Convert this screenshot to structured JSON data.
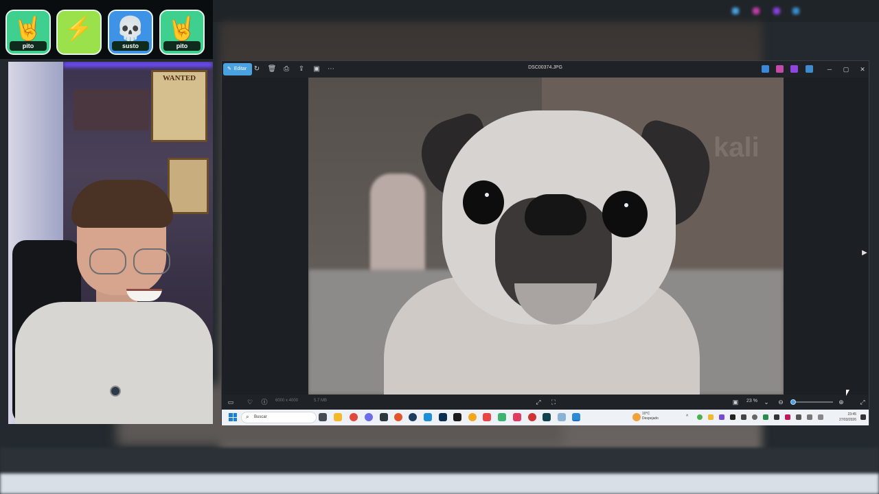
{
  "emotes": [
    {
      "label": "pito",
      "icon": "rock-hand-icon",
      "glyph": "🤘",
      "bg": "#3fcf8e"
    },
    {
      "label": "",
      "icon": "lightning-icon",
      "glyph": "⚡",
      "bg": "#9be14b"
    },
    {
      "label": "susto",
      "icon": "skull-icon",
      "glyph": "💀",
      "bg": "#3e93e6"
    },
    {
      "label": "pito",
      "icon": "rock-hand-icon",
      "glyph": "🤘",
      "bg": "#3fcf8e"
    }
  ],
  "webcam": {
    "poster_text": "WANTED"
  },
  "photos_app": {
    "edit_label": "Editar",
    "filename": "DSC00374.JPG",
    "toolbar_icons": [
      "rotate-icon",
      "delete-icon",
      "print-icon",
      "share-icon",
      "slideshow-icon",
      "more-icon"
    ],
    "status": {
      "dimensions": "6000 x 4000",
      "file_size": "5.7 MB",
      "zoom": "23 %"
    },
    "accent": "#4aa3e0"
  },
  "photo_watermark_text": "kali",
  "taskbar": {
    "search_placeholder": "Buscar",
    "weather_temp": "10°C",
    "weather_desc": "Despejado",
    "time": "23:45",
    "date": "27/03/2026",
    "apps": [
      "file-manager-icon",
      "folder-icon",
      "chrome-icon",
      "discord-icon",
      "terminal-icon",
      "firefox-icon",
      "steam-icon",
      "vscode-icon",
      "photoshop-icon",
      "capcut-icon",
      "chrome-canary-icon",
      "text-icon",
      "add-icon",
      "tiktok-icon",
      "game-icon",
      "app-icon",
      "tool-icon",
      "photos-icon"
    ]
  }
}
